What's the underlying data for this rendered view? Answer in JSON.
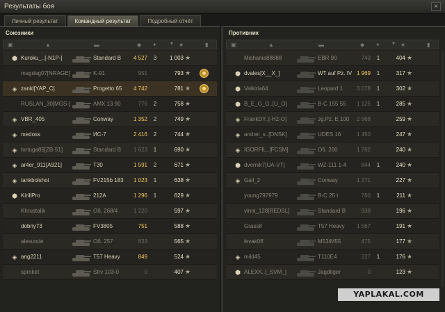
{
  "window": {
    "title": "Результаты боя",
    "close_glyph": "×"
  },
  "tabs": [
    {
      "label": "Личный результат",
      "active": false
    },
    {
      "label": "Командный результат",
      "active": true
    },
    {
      "label": "Подробный отчёт",
      "active": false
    }
  ],
  "allies": {
    "title": "Союзники",
    "header_icons": [
      "platoon-icon",
      "player-icon",
      "tank-icon",
      "damage-icon",
      "kills-icon",
      "sort-arrow-icon",
      "xp-star-icon",
      "medal-icon"
    ],
    "players": [
      {
        "name": "Kuroku_..[-N1P-]",
        "badge": "clan-badge-icon",
        "tank": "Standard B",
        "damage": "4 527",
        "kills": "3",
        "xp": "1 003",
        "alive": true
      },
      {
        "name": "magdag07[NRAGE]",
        "badge": "",
        "tank": "K-91",
        "damage": "951",
        "kills": "",
        "xp": "793",
        "alive": false,
        "medal": "medal-icon"
      },
      {
        "name": "zankl[YAP_C]",
        "badge": "diamond-icon",
        "tank": "Progetto 65",
        "damage": "4 742",
        "kills": "",
        "xp": "781",
        "alive": true,
        "self": true,
        "medal": "medal-icon"
      },
      {
        "name": "RUSLAN_30[MGS-]",
        "badge": "",
        "tank": "AMX 13 90",
        "damage": "776",
        "kills": "2",
        "xp": "758",
        "alive": false
      },
      {
        "name": "VBR_405",
        "badge": "diamond-icon",
        "tank": "Conway",
        "damage": "1 352",
        "kills": "2",
        "xp": "749",
        "alive": true
      },
      {
        "name": "medoss",
        "badge": "diamond-icon",
        "tank": "ИС-7",
        "damage": "2 416",
        "kills": "2",
        "xp": "744",
        "alive": true
      },
      {
        "name": "tortuga85[ZB-51]",
        "badge": "diamond-icon",
        "tank": "Standard B",
        "damage": "1 623",
        "kills": "1",
        "xp": "690",
        "alive": false
      },
      {
        "name": "ar4er_911[A921]",
        "badge": "diamond-icon",
        "tank": "T30",
        "damage": "1 591",
        "kills": "2",
        "xp": "671",
        "alive": true
      },
      {
        "name": "tankbolshoi",
        "badge": "diamond-icon",
        "tank": "FV215b 183",
        "damage": "1 023",
        "kills": "1",
        "xp": "638",
        "alive": true
      },
      {
        "name": "KirillPro",
        "badge": "clan-badge-icon",
        "tank": "212A",
        "damage": "1 296",
        "kills": "1",
        "xp": "629",
        "alive": true
      },
      {
        "name": "Khrustalik",
        "badge": "",
        "tank": "Об. 268/4",
        "damage": "1 220",
        "kills": "",
        "xp": "597",
        "alive": false
      },
      {
        "name": "dobriy73",
        "badge": "",
        "tank": "FV3805",
        "damage": "751",
        "kills": "",
        "xp": "588",
        "alive": true
      },
      {
        "name": "alesunde",
        "badge": "",
        "tank": "Об. 257",
        "damage": "833",
        "kills": "",
        "xp": "565",
        "alive": false
      },
      {
        "name": "ang2211",
        "badge": "diamond-icon",
        "tank": "T57 Heavy",
        "damage": "849",
        "kills": "",
        "xp": "524",
        "alive": true
      },
      {
        "name": "sproket",
        "badge": "",
        "tank": "Strv 103-0",
        "damage": "0",
        "kills": "",
        "xp": "407",
        "alive": false
      }
    ]
  },
  "enemies": {
    "title": "Противник",
    "header_icons": [
      "platoon-icon",
      "player-icon",
      "tank-icon",
      "damage-icon",
      "kills-icon",
      "sort-arrow-icon",
      "xp-star-icon",
      "medal-icon"
    ],
    "players": [
      {
        "name": "Mishania88888",
        "badge": "",
        "tank": "EBR 90",
        "damage": "743",
        "kills": "1",
        "xp": "404",
        "alive": false
      },
      {
        "name": "dvales[X__X_]",
        "badge": "clan-badge-icon",
        "tank": "WT auf Pz. IV",
        "damage": "1 969",
        "kills": "1",
        "xp": "317",
        "alive": true
      },
      {
        "name": "Valkiria64",
        "badge": "clan-badge-icon",
        "tank": "Leopard 1",
        "damage": "3 078",
        "kills": "1",
        "xp": "302",
        "alive": false
      },
      {
        "name": "B_E_G_G..[U_O]",
        "badge": "clan-badge-icon",
        "tank": "B-C 155 55",
        "damage": "1 125",
        "kills": "1",
        "xp": "285",
        "alive": false
      },
      {
        "name": "FrankDY..[-H2-O]",
        "badge": "diamond-icon",
        "tank": "Jg.Pz. E 100",
        "damage": "2 968",
        "kills": "",
        "xp": "259",
        "alive": false
      },
      {
        "name": "andrei_s..[DNSK]",
        "badge": "diamond-icon",
        "tank": "UDES 16",
        "damage": "1 450",
        "kills": "",
        "xp": "247",
        "alive": false
      },
      {
        "name": "IGORFIL..[FCSM]",
        "badge": "diamond-icon",
        "tank": "Об. 260",
        "damage": "1 762",
        "kills": "",
        "xp": "240",
        "alive": false
      },
      {
        "name": "dvernik7[UA-VT]",
        "badge": "clan-badge-icon",
        "tank": "WZ-111 1-4",
        "damage": "844",
        "kills": "1",
        "xp": "240",
        "alive": false
      },
      {
        "name": "Gall_2",
        "badge": "diamond-icon",
        "tank": "Conway",
        "damage": "1 271",
        "kills": "",
        "xp": "227",
        "alive": false
      },
      {
        "name": "young797979",
        "badge": "",
        "tank": "B-C 25 t",
        "damage": "760",
        "kills": "1",
        "xp": "211",
        "alive": false
      },
      {
        "name": "vinni_128[REDSL]",
        "badge": "",
        "tank": "Standard B",
        "damage": "938",
        "kills": "",
        "xp": "196",
        "alive": false
      },
      {
        "name": "Grass8",
        "badge": "",
        "tank": "T57 Heavy",
        "damage": "1 567",
        "kills": "",
        "xp": "191",
        "alive": false
      },
      {
        "name": "levak0ff",
        "badge": "",
        "tank": "M53/M55",
        "damage": "475",
        "kills": "",
        "xp": "177",
        "alive": false
      },
      {
        "name": "mild45",
        "badge": "diamond-icon",
        "tank": "T110E4",
        "damage": "227",
        "kills": "1",
        "xp": "176",
        "alive": false
      },
      {
        "name": "ALEXK..[_SVM_]",
        "badge": "clan-badge-icon",
        "tank": "Jagdtiger",
        "damage": "0",
        "kills": "",
        "xp": "123",
        "alive": false
      }
    ]
  },
  "watermark": {
    "text": "YAPLAKAL.COM"
  },
  "colors": {
    "damage_high": "#f0c95a",
    "damage_low": "#6e6a5e",
    "ally_tank": "#3a3a32",
    "self_row": "#3b3223"
  }
}
